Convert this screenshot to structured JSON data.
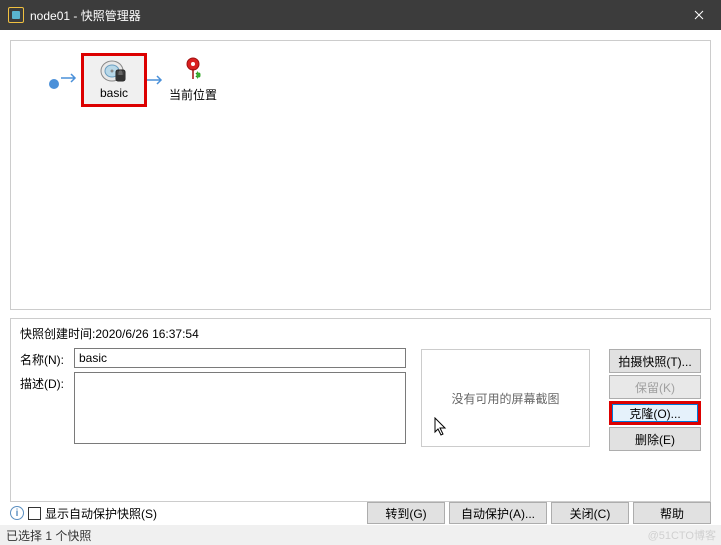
{
  "titlebar": {
    "title": "node01 - 快照管理器",
    "close_label": "×"
  },
  "graph": {
    "snapshot_label": "basic",
    "current_label": "当前位置"
  },
  "details": {
    "created_label_prefix": "快照创建时间:",
    "created_time": "2020/6/26 16:37:54",
    "name_label": "名称(N):",
    "name_value": "basic",
    "desc_label": "描述(D):",
    "desc_value": "",
    "screenshot_empty": "没有可用的屏幕截图"
  },
  "right_buttons": {
    "take": "拍摄快照(T)...",
    "keep": "保留(K)",
    "clone": "克隆(O)...",
    "delete": "删除(E)"
  },
  "bottom": {
    "auto_protect_checkbox": "显示自动保护快照(S)",
    "goto": "转到(G)",
    "auto_protect": "自动保护(A)...",
    "close": "关闭(C)",
    "help": "帮助"
  },
  "status": {
    "text": "已选择 1 个快照"
  },
  "watermark": "@51CTO博客"
}
